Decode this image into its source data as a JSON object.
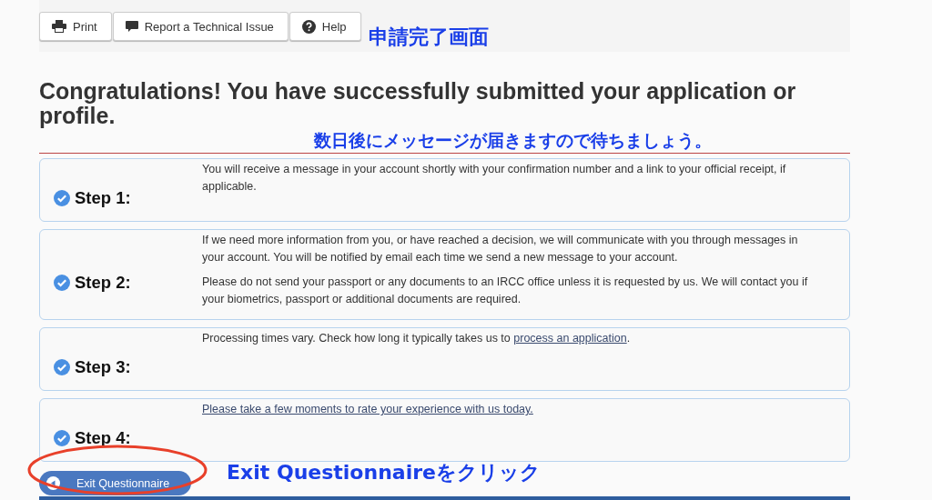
{
  "toolbar": {
    "buttons": [
      {
        "label": "Print",
        "kind": "print"
      },
      {
        "label": "Report a Technical Issue",
        "kind": "report"
      },
      {
        "label": "Help",
        "kind": "help"
      }
    ]
  },
  "annotations": [
    {
      "text": "申請完了画面",
      "kind": "top"
    },
    {
      "text": "数日後にメッセージが届きますので待ちましょう。",
      "kind": "heading"
    },
    {
      "text": "Exit Questionnaireをクリック",
      "kind": "exit"
    }
  ],
  "heading": "Congratulations! You have successfully submitted your application or profile.",
  "steps": [
    {
      "label": "Step 1:",
      "done": true,
      "paragraphs": [
        [
          {
            "kind": "text",
            "text": "You will receive a message in your account shortly with your confirmation number and a link to your official receipt, if applicable."
          }
        ]
      ]
    },
    {
      "label": "Step 2:",
      "done": true,
      "paragraphs": [
        [
          {
            "kind": "text",
            "text": "If we need more information from you, or have reached a decision, we will communicate with you through messages in your account. You will be notified by email each time we send a new message to your account."
          }
        ],
        [
          {
            "kind": "text",
            "text": "Please do not send your passport or any documents to an IRCC office unless it is requested by us. We will contact you if your biometrics, passport or additional documents are required."
          }
        ]
      ]
    },
    {
      "label": "Step 3:",
      "done": true,
      "paragraphs": [
        [
          {
            "kind": "text",
            "text": "Processing times vary. Check how long it typically takes us to "
          },
          {
            "kind": "link",
            "text": "process an application"
          },
          {
            "kind": "text",
            "text": "."
          }
        ]
      ]
    },
    {
      "label": "Step 4:",
      "done": true,
      "paragraphs": [
        [
          {
            "kind": "link",
            "text": "Please take a few moments to rate your experience with us today."
          }
        ]
      ]
    }
  ],
  "exit_button": {
    "label": "Exit Questionnaire",
    "highlighted": true
  }
}
